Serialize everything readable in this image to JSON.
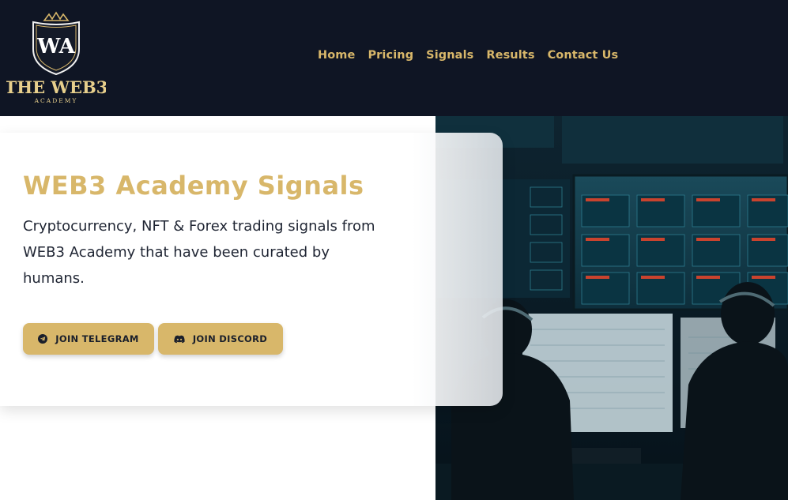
{
  "brand": {
    "monogram": "WA",
    "name": "THE WEB3",
    "sub": "ACADEMY"
  },
  "nav": {
    "items": [
      {
        "label": "Home"
      },
      {
        "label": "Pricing"
      },
      {
        "label": "Signals"
      },
      {
        "label": "Results"
      },
      {
        "label": "Contact Us"
      }
    ]
  },
  "hero": {
    "title": "WEB3 Academy Signals",
    "description": "Cryptocurrency, NFT & Forex trading signals from WEB3 Academy that have been curated by humans.",
    "buttons": {
      "telegram": "JOIN TELEGRAM",
      "discord": "JOIN DISCORD"
    },
    "image_icon": "trading-room-image"
  },
  "colors": {
    "gold": "#d8b76a",
    "header_bg": "#0f1524",
    "text_dark": "#1f2533"
  }
}
